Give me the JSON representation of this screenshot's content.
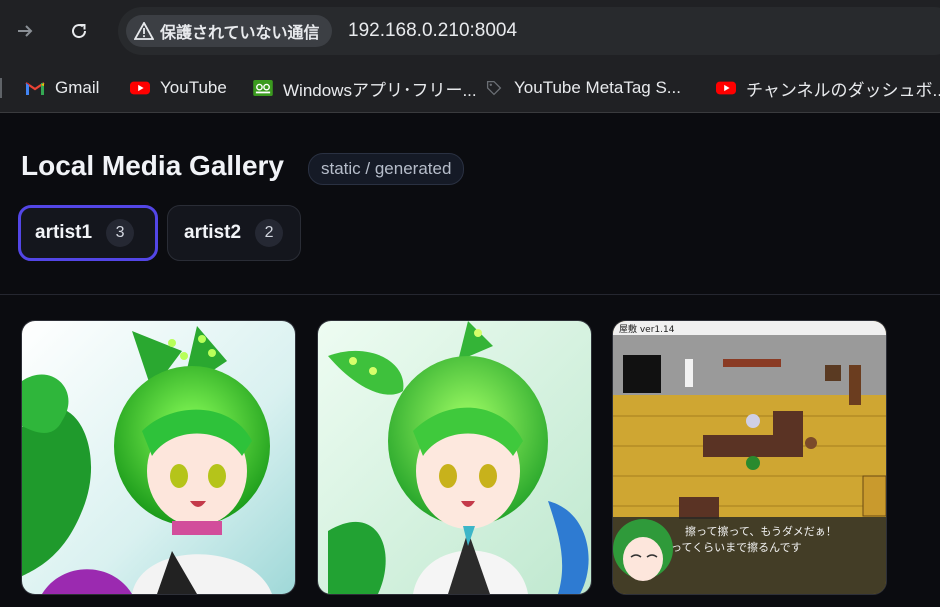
{
  "browser": {
    "security_label": "保護されていない通信",
    "url": "192.168.0.210:8004",
    "bookmarks": [
      {
        "label": "Gmail",
        "icon": "gmail-icon"
      },
      {
        "label": "YouTube",
        "icon": "youtube-icon"
      },
      {
        "label": "Windowsアプリ･フリー...",
        "icon": "app-icon"
      },
      {
        "label": "YouTube MetaTag S...",
        "icon": "tag-icon"
      },
      {
        "label": "チャンネルのダッシュボ...",
        "icon": "youtube-icon"
      }
    ]
  },
  "page": {
    "title": "Local Media Gallery",
    "badge": "static / generated",
    "artists": [
      {
        "name": "artist1",
        "count": "3",
        "active": true
      },
      {
        "name": "artist2",
        "count": "2",
        "active": false
      }
    ]
  },
  "gallery": {
    "items": [
      {
        "kind": "illustration",
        "subject": "green-haired character with ribbon ears"
      },
      {
        "kind": "illustration",
        "subject": "green-haired character with ribbon ears"
      },
      {
        "kind": "game-screenshot",
        "window_title": "屋敷 ver1.14",
        "dialog_line1": "擦って擦って、もうダメだぁ！",
        "dialog_line2": "ってくらいまで擦るんです"
      }
    ]
  },
  "colors": {
    "page_bg": "#0b0c10",
    "chrome_bg": "#202124",
    "active_tab_border": "#5346e6"
  }
}
